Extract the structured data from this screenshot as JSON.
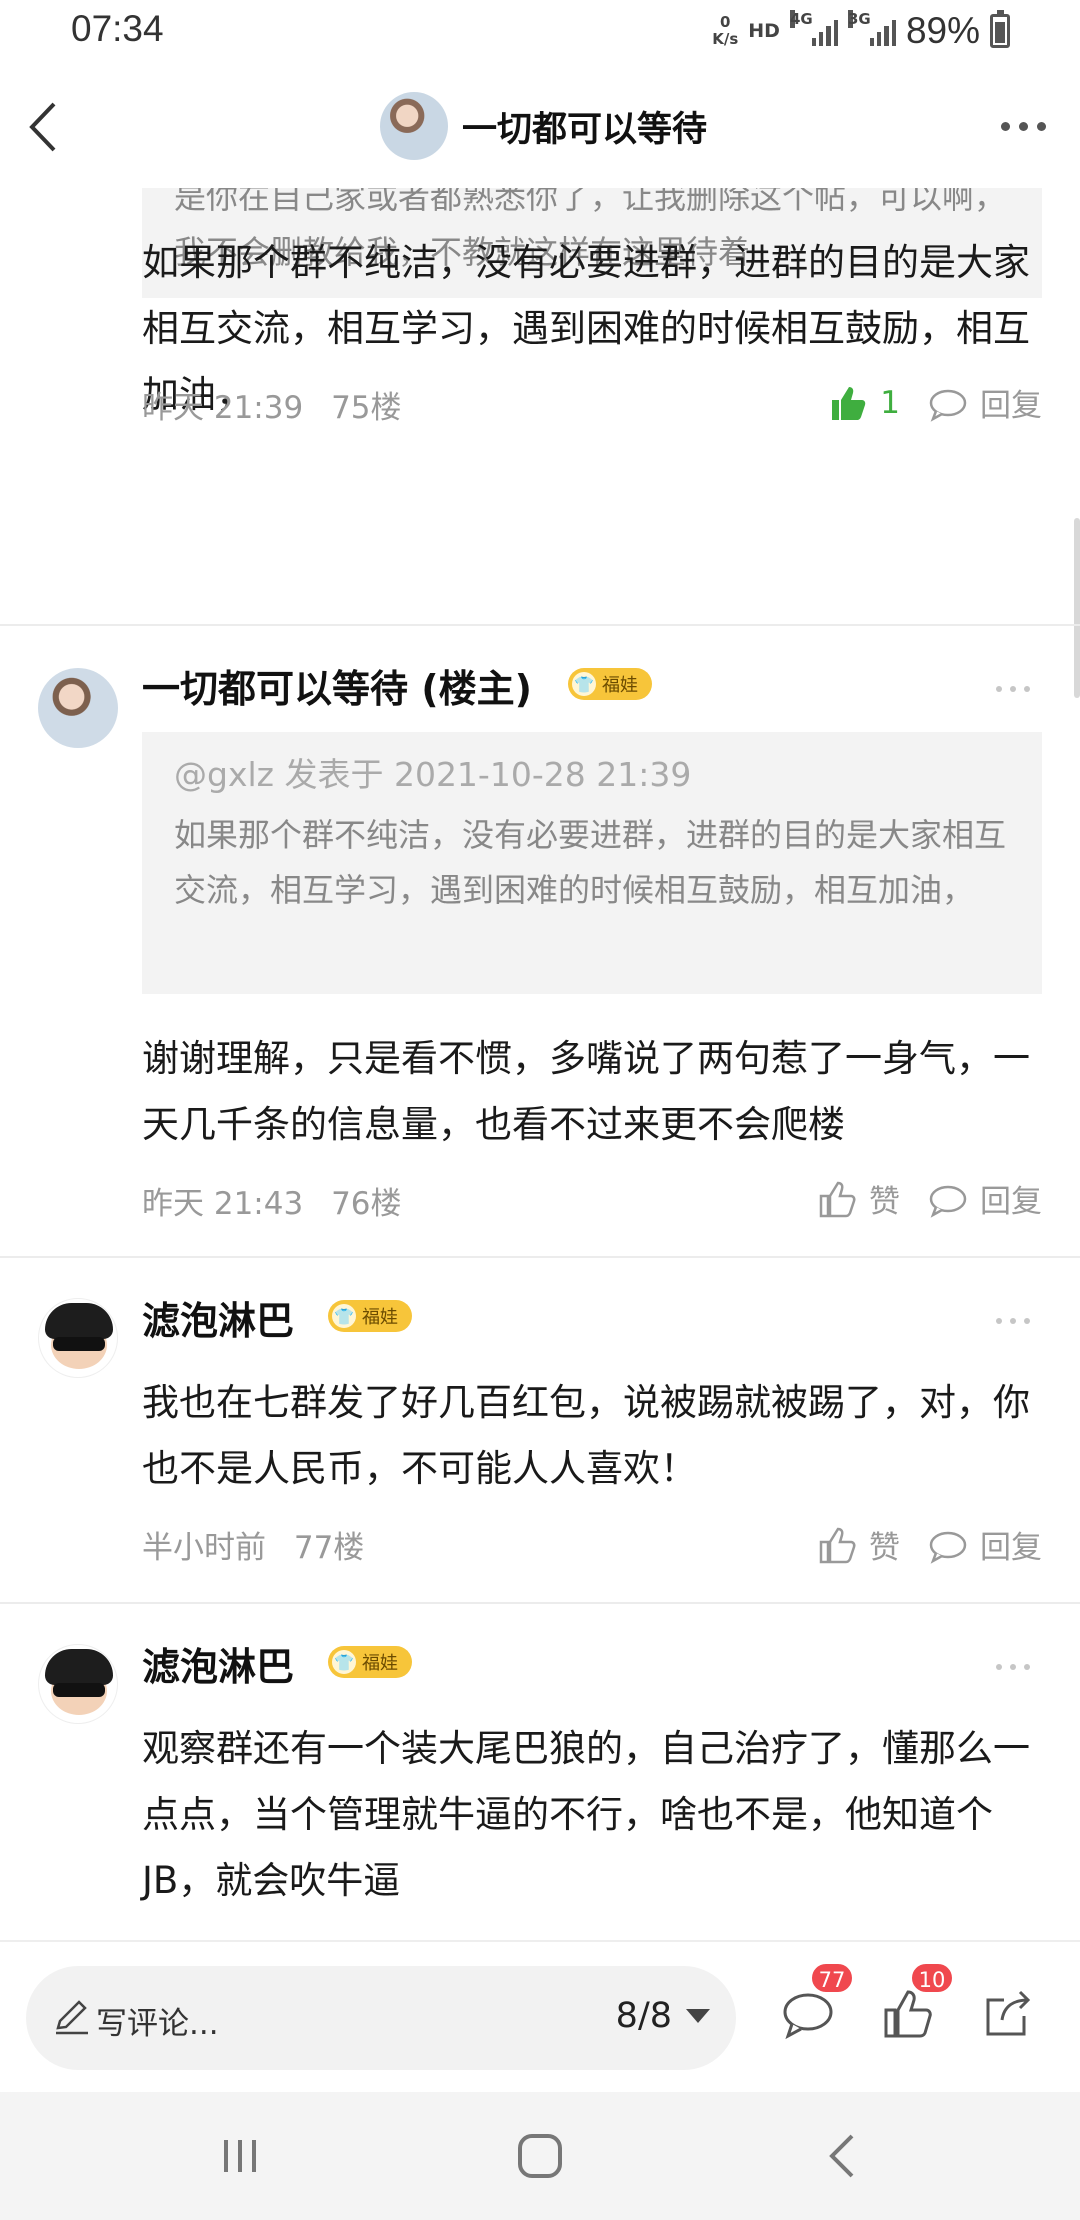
{
  "status_bar": {
    "time": "07:34",
    "net_speed_value": "0",
    "net_speed_unit": "K/s",
    "hd": "HD",
    "signal_1_label": "4G",
    "signal_2_label": "3G",
    "battery": "89%",
    "battery_level": 0.89
  },
  "topbar": {
    "title": "一切都可以等待",
    "back_icon": "chevron-left-icon",
    "more_icon": "more-horizontal-icon"
  },
  "posts": {
    "top_quote_partial": "是你在自己家或者都熟悉你了，让我删除这个帖，可以啊，我不会删教给我，不教就这样在这里待着",
    "p75": {
      "text": "如果那个群不纯洁，没有必要进群，进群的目的是大家相互交流，相互学习，遇到困难的时候相互鼓励，相互加油，",
      "time": "昨天 21:39",
      "floor": "75楼",
      "like_count": "1",
      "reply": "回复"
    },
    "p76": {
      "username": "一切都可以等待 (楼主)",
      "badge": "福娃",
      "quote_head": "@gxlz 发表于 2021-10-28 21:39",
      "quote_body": "如果那个群不纯洁，没有必要进群，进群的目的是大家相互交流，相互学习，遇到困难的时候相互鼓励，相互加油，",
      "text": "谢谢理解，只是看不惯，多嘴说了两句惹了一身气，一天几千条的信息量，也看不过来更不会爬楼",
      "time": "昨天 21:43",
      "floor": "76楼",
      "like": "赞",
      "reply": "回复"
    },
    "p77": {
      "username": "滤泡淋巴",
      "badge": "福娃",
      "text": "我也在七群发了好几百红包，说被踢就被踢了，对，你也不是人民币，不可能人人喜欢！",
      "time": "半小时前",
      "floor": "77楼",
      "like": "赞",
      "reply": "回复"
    },
    "p78": {
      "username": "滤泡淋巴",
      "badge": "福娃",
      "text": "观察群还有一个装大尾巴狼的，自己治疗了，懂那么一点点，当个管理就牛逼的不行，啥也不是，他知道个JB，就会吹牛逼"
    }
  },
  "bottom_bar": {
    "placeholder": "写评论...",
    "page_indicator": "8/8",
    "comment_count": "77",
    "like_count": "10"
  },
  "colors": {
    "like_green": "#3fae3f",
    "badge_yellow": "#f7c53a",
    "notification_red": "#f0484e"
  }
}
